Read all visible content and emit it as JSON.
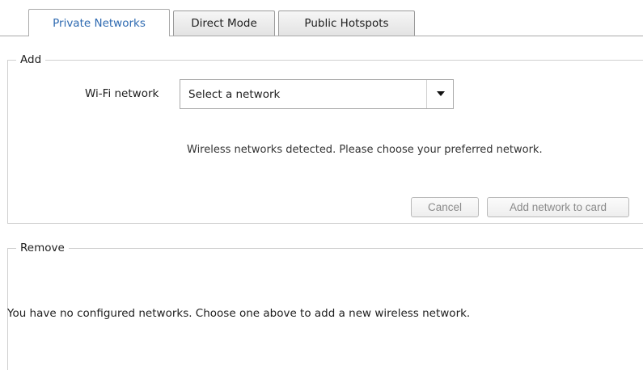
{
  "tabs": [
    {
      "label": "Private Networks",
      "active": true
    },
    {
      "label": "Direct Mode",
      "active": false
    },
    {
      "label": "Public Hotspots",
      "active": false
    }
  ],
  "add_section": {
    "legend": "Add",
    "wifi_label": "Wi-Fi network",
    "network_select": {
      "value": "Select a network"
    },
    "status_message": "Wireless networks detected. Please choose your preferred network.",
    "cancel_label": "Cancel",
    "add_label": "Add network to card"
  },
  "remove_section": {
    "legend": "Remove",
    "message": "You have no configured networks. Choose one above to add a new wireless network."
  },
  "colors": {
    "active_tab_text": "#2e6ab1",
    "border": "#cfcfcf",
    "disabled_text": "#8a8a8a"
  }
}
